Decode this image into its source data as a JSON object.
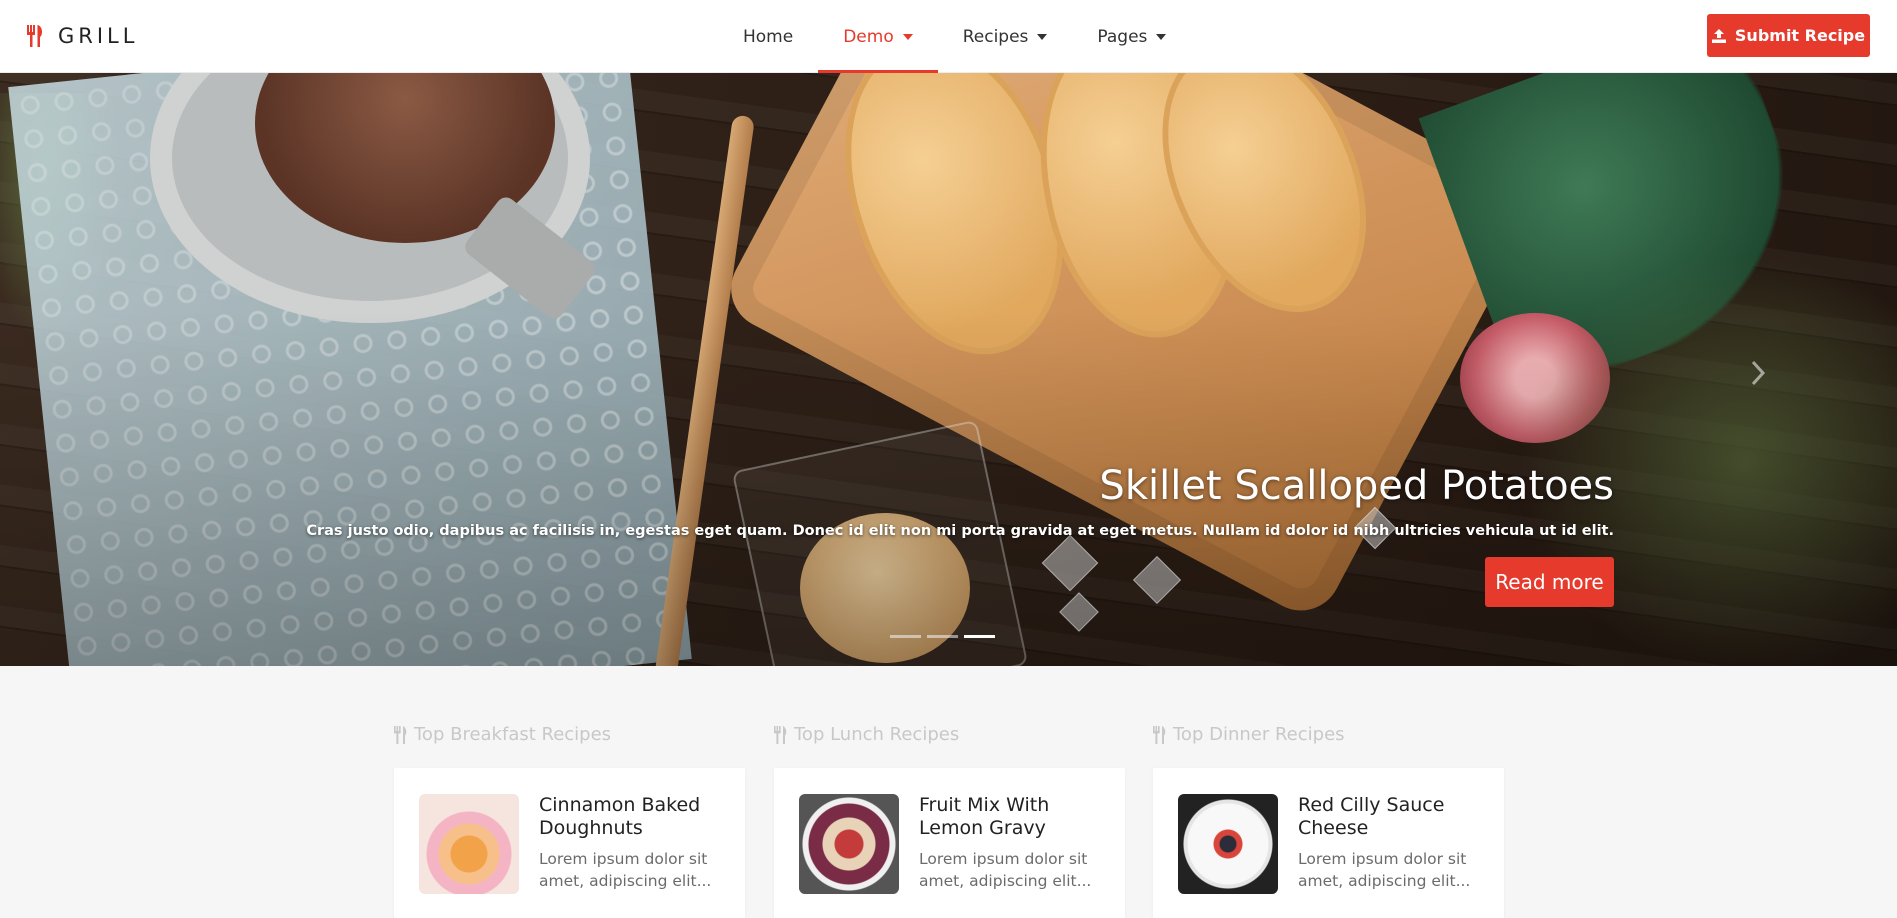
{
  "brand": {
    "name": "GRILL",
    "icon": "utensils-icon",
    "accent": "#e53a2c"
  },
  "nav": {
    "items": [
      {
        "label": "Home",
        "dropdown": false,
        "active": false
      },
      {
        "label": "Demo",
        "dropdown": true,
        "active": true
      },
      {
        "label": "Recipes",
        "dropdown": true,
        "active": false
      },
      {
        "label": "Pages",
        "dropdown": true,
        "active": false
      }
    ],
    "submit_label": "Submit Recipe",
    "submit_icon": "upload-icon"
  },
  "hero": {
    "title": "Skillet Scalloped Potatoes",
    "text": "Cras justo odio, dapibus ac facilisis in, egestas eget quam. Donec id elit non mi porta gravida at eget metus. Nullam id dolor id nibh ultricies vehicula ut id elit.",
    "button": "Read more",
    "indicators": 3,
    "active_indicator": 3
  },
  "columns": [
    {
      "heading": "Top Breakfast Recipes",
      "card": {
        "title": "Cinnamon Baked Doughnuts",
        "text": "Lorem ipsum dolor sit amet, adipiscing elit..."
      }
    },
    {
      "heading": "Top Lunch Recipes",
      "card": {
        "title": "Fruit Mix With Lemon Gravy",
        "text": "Lorem ipsum dolor sit amet, adipiscing elit..."
      }
    },
    {
      "heading": "Top Dinner Recipes",
      "card": {
        "title": "Red Cilly Sauce Cheese",
        "text": "Lorem ipsum dolor sit amet, adipiscing elit..."
      }
    }
  ]
}
